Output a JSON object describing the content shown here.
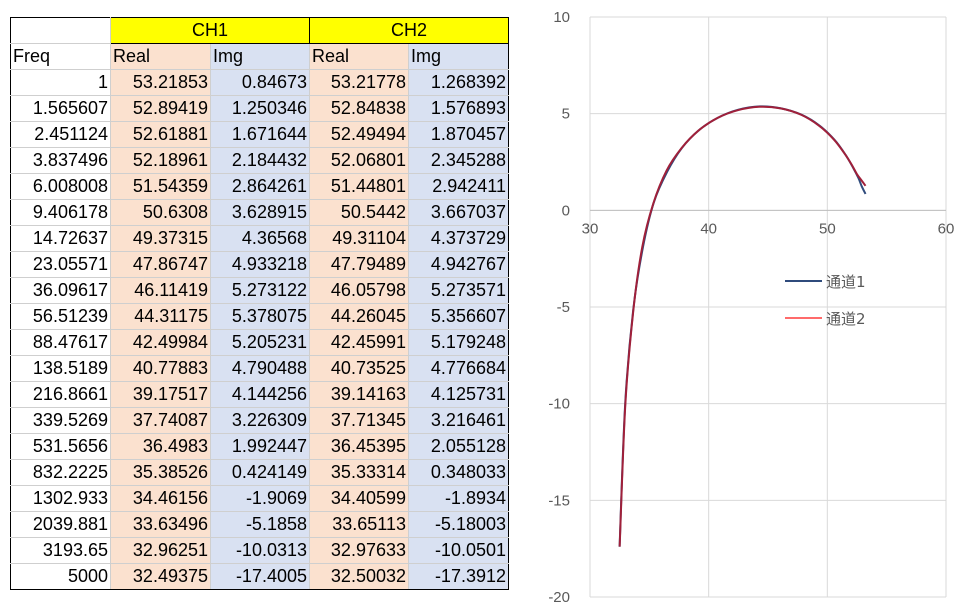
{
  "table": {
    "group_headers": [
      "CH1",
      "CH2"
    ],
    "col_headers": [
      "Freq",
      "Real",
      "Img",
      "Real",
      "Img"
    ],
    "rows": [
      [
        "1",
        "53.21853",
        "0.84673",
        "53.21778",
        "1.268392"
      ],
      [
        "1.565607",
        "52.89419",
        "1.250346",
        "52.84838",
        "1.576893"
      ],
      [
        "2.451124",
        "52.61881",
        "1.671644",
        "52.49494",
        "1.870457"
      ],
      [
        "3.837496",
        "52.18961",
        "2.184432",
        "52.06801",
        "2.345288"
      ],
      [
        "6.008008",
        "51.54359",
        "2.864261",
        "51.44801",
        "2.942411"
      ],
      [
        "9.406178",
        "50.6308",
        "3.628915",
        "50.5442",
        "3.667037"
      ],
      [
        "14.72637",
        "49.37315",
        "4.36568",
        "49.31104",
        "4.373729"
      ],
      [
        "23.05571",
        "47.86747",
        "4.933218",
        "47.79489",
        "4.942767"
      ],
      [
        "36.09617",
        "46.11419",
        "5.273122",
        "46.05798",
        "5.273571"
      ],
      [
        "56.51239",
        "44.31175",
        "5.378075",
        "44.26045",
        "5.356607"
      ],
      [
        "88.47617",
        "42.49984",
        "5.205231",
        "42.45991",
        "5.179248"
      ],
      [
        "138.5189",
        "40.77883",
        "4.790488",
        "40.73525",
        "4.776684"
      ],
      [
        "216.8661",
        "39.17517",
        "4.144256",
        "39.14163",
        "4.125731"
      ],
      [
        "339.5269",
        "37.74087",
        "3.226309",
        "37.71345",
        "3.216461"
      ],
      [
        "531.5656",
        "36.4983",
        "1.992447",
        "36.45395",
        "2.055128"
      ],
      [
        "832.2225",
        "35.38526",
        "0.424149",
        "35.33314",
        "0.348033"
      ],
      [
        "1302.933",
        "34.46156",
        "-1.9069",
        "34.40599",
        "-1.8934"
      ],
      [
        "2039.881",
        "33.63496",
        "-5.1858",
        "33.65113",
        "-5.18003"
      ],
      [
        "3193.65",
        "32.96251",
        "-10.0313",
        "32.97633",
        "-10.0501"
      ],
      [
        "5000",
        "32.49375",
        "-17.4005",
        "32.50032",
        "-17.3912"
      ]
    ]
  },
  "chart_data": {
    "type": "scatter",
    "xlim": [
      30,
      60
    ],
    "ylim": [
      -20,
      10
    ],
    "x_ticks": [
      "30",
      "40",
      "50",
      "60"
    ],
    "y_ticks": [
      "10",
      "5",
      "0",
      "-5",
      "-10",
      "-15",
      "-20"
    ],
    "grid": true,
    "legend_position": "center-right",
    "series": [
      {
        "name": "通道1",
        "color": "#2f4b7c",
        "x": [
          53.21853,
          52.89419,
          52.61881,
          52.18961,
          51.54359,
          50.6308,
          49.37315,
          47.86747,
          46.11419,
          44.31175,
          42.49984,
          40.77883,
          39.17517,
          37.74087,
          36.4983,
          35.38526,
          34.46156,
          33.63496,
          32.96251,
          32.49375
        ],
        "y": [
          0.84673,
          1.250346,
          1.671644,
          2.184432,
          2.864261,
          3.628915,
          4.36568,
          4.933218,
          5.273122,
          5.378075,
          5.205231,
          4.790488,
          4.144256,
          3.226309,
          1.992447,
          0.424149,
          -1.9069,
          -5.1858,
          -10.0313,
          -17.4005
        ]
      },
      {
        "name": "通道2",
        "color": "#ff6b6b",
        "x": [
          53.21778,
          52.84838,
          52.49494,
          52.06801,
          51.44801,
          50.5442,
          49.31104,
          47.79489,
          46.05798,
          44.26045,
          42.45991,
          40.73525,
          39.14163,
          37.71345,
          36.45395,
          35.33314,
          34.40599,
          33.65113,
          32.97633,
          32.50032
        ],
        "y": [
          1.268392,
          1.576893,
          1.870457,
          2.345288,
          2.942411,
          3.667037,
          4.373729,
          4.942767,
          5.273571,
          5.356607,
          5.179248,
          4.776684,
          4.125731,
          3.216461,
          2.055128,
          0.348033,
          -1.8934,
          -5.18003,
          -10.0501,
          -17.3912
        ]
      }
    ],
    "overlay_color": "#a0203a"
  }
}
